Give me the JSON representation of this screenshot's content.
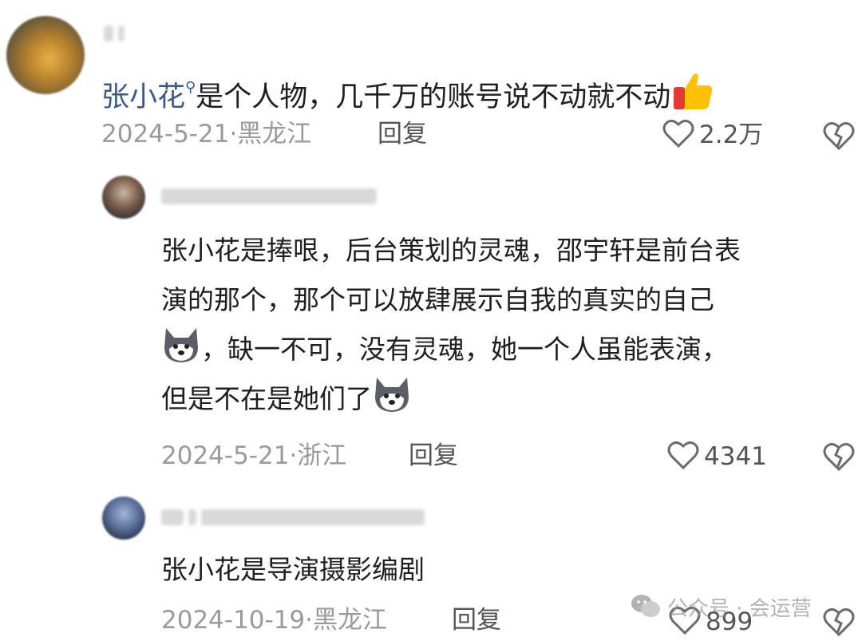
{
  "comments": [
    {
      "mention": "张小花",
      "text": "是个人物，几千万的账号说不动就不动",
      "date": "2024-5-21",
      "location": "黑龙江",
      "reply_label": "回复",
      "likes": "2.2万"
    },
    {
      "text_line1": "张小花是捧哏，后台策划的灵魂，邵宇轩是前台表",
      "text_line2": "演的那个，那个可以放肆展示自我的真实的自己",
      "text_line3": "，缺一不可，没有灵魂，她一个人虽能表演，",
      "text_line4": "但是不在是她们了",
      "date": "2024-5-21",
      "location": "浙江",
      "reply_label": "回复",
      "likes": "4341"
    },
    {
      "text": "张小花是导演摄影编剧",
      "date": "2024-10-19",
      "location": "黑龙江",
      "reply_label": "回复",
      "likes": "899"
    }
  ],
  "watermark": {
    "text": "公众号 · 会运营"
  },
  "colors": {
    "mention": "#3b5a8a",
    "meta": "#9a9a9a",
    "icon": "#6b6b6b"
  }
}
